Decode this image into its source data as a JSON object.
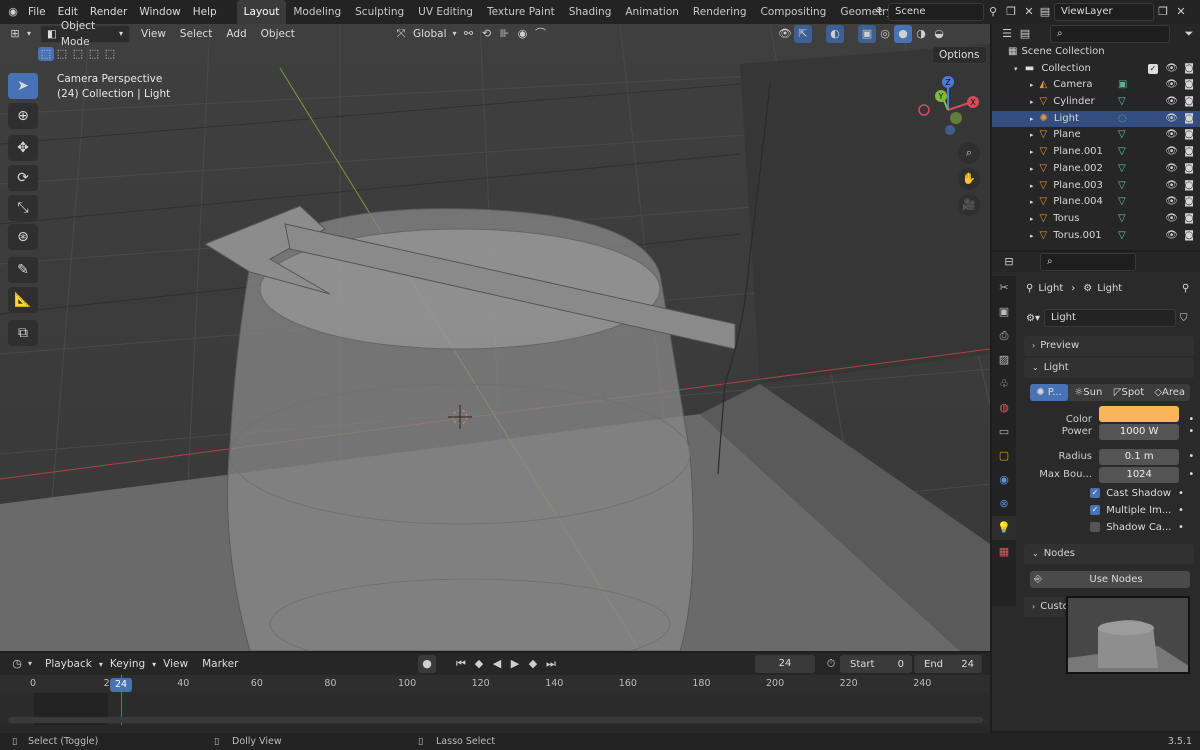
{
  "menu": [
    "File",
    "Edit",
    "Render",
    "Window",
    "Help"
  ],
  "workspaces": [
    "Layout",
    "Modeling",
    "Sculpting",
    "UV Editing",
    "Texture Paint",
    "Shading",
    "Animation",
    "Rendering",
    "Compositing",
    "Geometry Nodes"
  ],
  "active_workspace": "Layout",
  "scene": "Scene",
  "view_layer": "ViewLayer",
  "viewport_header": {
    "mode": "Object Mode",
    "menus": [
      "View",
      "Select",
      "Add",
      "Object"
    ],
    "orientation": "Global",
    "options": "Options"
  },
  "viewport_overlay": {
    "line1": "Camera Perspective",
    "line2": "(24) Collection | Light"
  },
  "gizmo": {
    "x": "X",
    "y": "Y",
    "z": "Z"
  },
  "outliner": {
    "root": "Scene Collection",
    "collection": "Collection",
    "items": [
      {
        "name": "Camera",
        "type": "camera"
      },
      {
        "name": "Cylinder",
        "type": "mesh"
      },
      {
        "name": "Light",
        "type": "light",
        "selected": true
      },
      {
        "name": "Plane",
        "type": "mesh"
      },
      {
        "name": "Plane.001",
        "type": "mesh"
      },
      {
        "name": "Plane.002",
        "type": "mesh"
      },
      {
        "name": "Plane.003",
        "type": "mesh"
      },
      {
        "name": "Plane.004",
        "type": "mesh"
      },
      {
        "name": "Torus",
        "type": "mesh"
      },
      {
        "name": "Torus.001",
        "type": "mesh"
      }
    ]
  },
  "properties": {
    "breadcrumb": [
      "Light",
      "Light"
    ],
    "datablock": "Light",
    "panel_preview": "Preview",
    "panel_light": "Light",
    "light_types": [
      "P...",
      "Sun",
      "Spot",
      "Area"
    ],
    "color_label": "Color",
    "color_value": "#f7b65a",
    "power_label": "Power",
    "power_value": "1000 W",
    "radius_label": "Radius",
    "radius_value": "0.1 m",
    "maxbounce_label": "Max Bou...",
    "maxbounce_value": "1024",
    "cast_shadow": "Cast Shadow",
    "multiple_importance": "Multiple Im...",
    "shadow_caustics": "Shadow Ca...",
    "panel_nodes": "Nodes",
    "use_nodes": "Use Nodes",
    "panel_custom": "Custo"
  },
  "timeline": {
    "menus": [
      "Playback",
      "Keying",
      "View",
      "Marker"
    ],
    "current_frame": "24",
    "start_label": "Start",
    "start_value": "0",
    "end_label": "End",
    "end_value": "24",
    "ticks": [
      "0",
      "20",
      "40",
      "60",
      "80",
      "100",
      "120",
      "140",
      "160",
      "180",
      "200",
      "220",
      "240"
    ]
  },
  "status": {
    "left": "Select (Toggle)",
    "middle": "Dolly View",
    "right": "Lasso Select",
    "version": "3.5.1"
  }
}
